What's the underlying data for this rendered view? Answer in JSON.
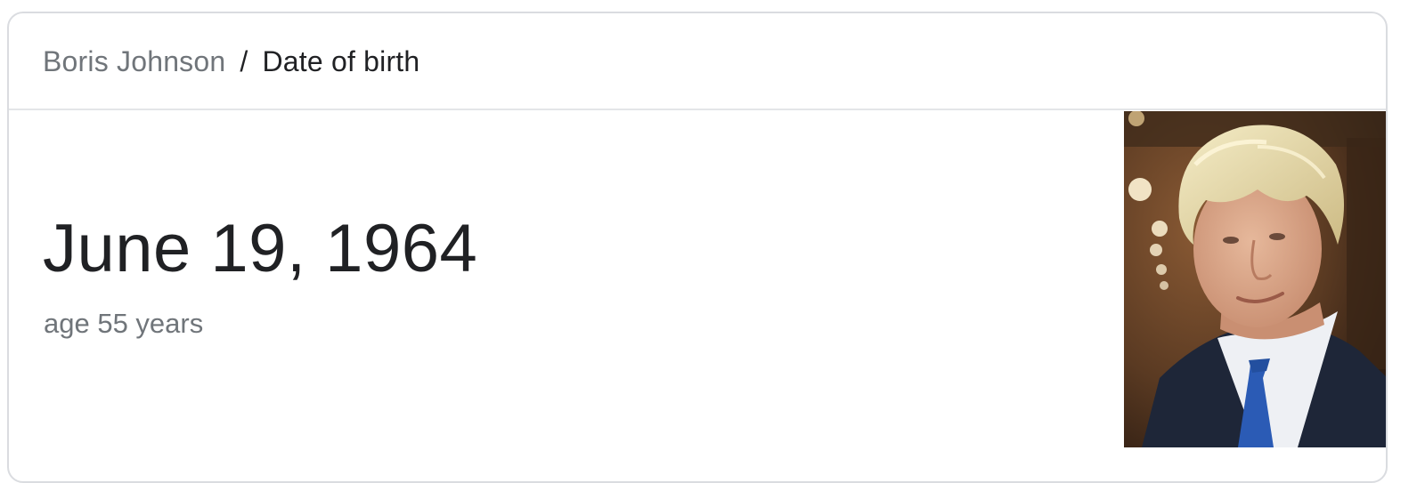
{
  "breadcrumb": {
    "parent": "Boris Johnson",
    "separator": "/",
    "current": "Date of birth"
  },
  "answer": {
    "date": "June 19, 1964",
    "age": "age 55 years"
  },
  "portrait": {
    "icon": "person-photo",
    "colors": {
      "background": "#5a3a22",
      "hair": "#e8dcae",
      "skin": "#d9a98b",
      "suit": "#1e2638",
      "shirt": "#eef0f4",
      "tie": "#2b5bb5"
    }
  }
}
